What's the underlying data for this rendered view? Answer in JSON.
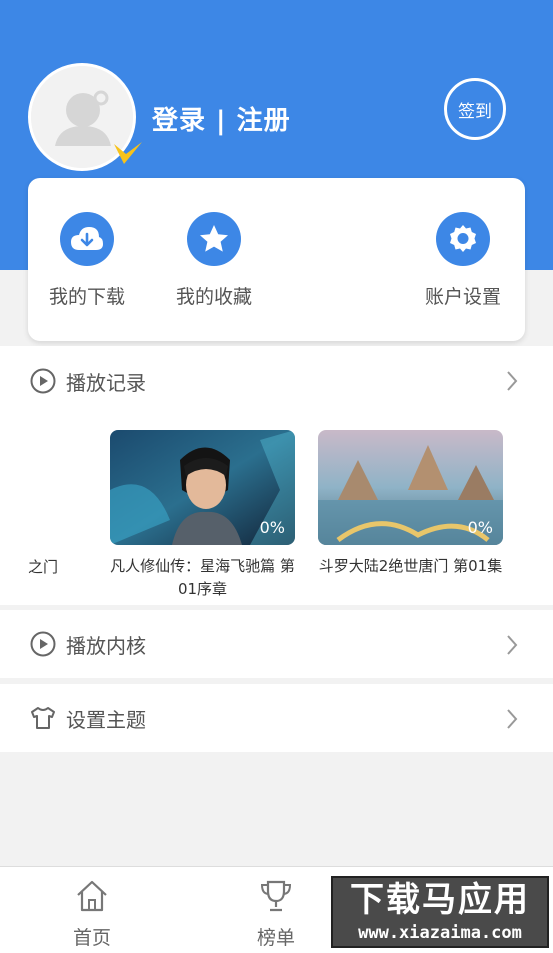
{
  "header": {
    "login_text": "登录 | 注册",
    "signin_label": "签到",
    "accent_color": "#3d87e6"
  },
  "quick_actions": [
    {
      "label": "我的下载",
      "icon": "cloud-download-icon"
    },
    {
      "label": "我的收藏",
      "icon": "star-icon"
    },
    {
      "label": "账户设置",
      "icon": "gear-icon"
    }
  ],
  "history": {
    "title": "播放记录",
    "partial_item_title": "之门",
    "items": [
      {
        "title": "凡人修仙传：星海飞驰篇 第01序章",
        "progress": "0%"
      },
      {
        "title": "斗罗大陆2绝世唐门 第01集",
        "progress": "0%"
      }
    ]
  },
  "menu": {
    "player_core": "播放内核",
    "theme": "设置主题"
  },
  "tabs": [
    {
      "label": "首页",
      "icon": "home-icon"
    },
    {
      "label": "榜单",
      "icon": "trophy-icon"
    }
  ],
  "watermark": {
    "top": "下载马应用",
    "bottom": "www.xiazaima.com"
  }
}
